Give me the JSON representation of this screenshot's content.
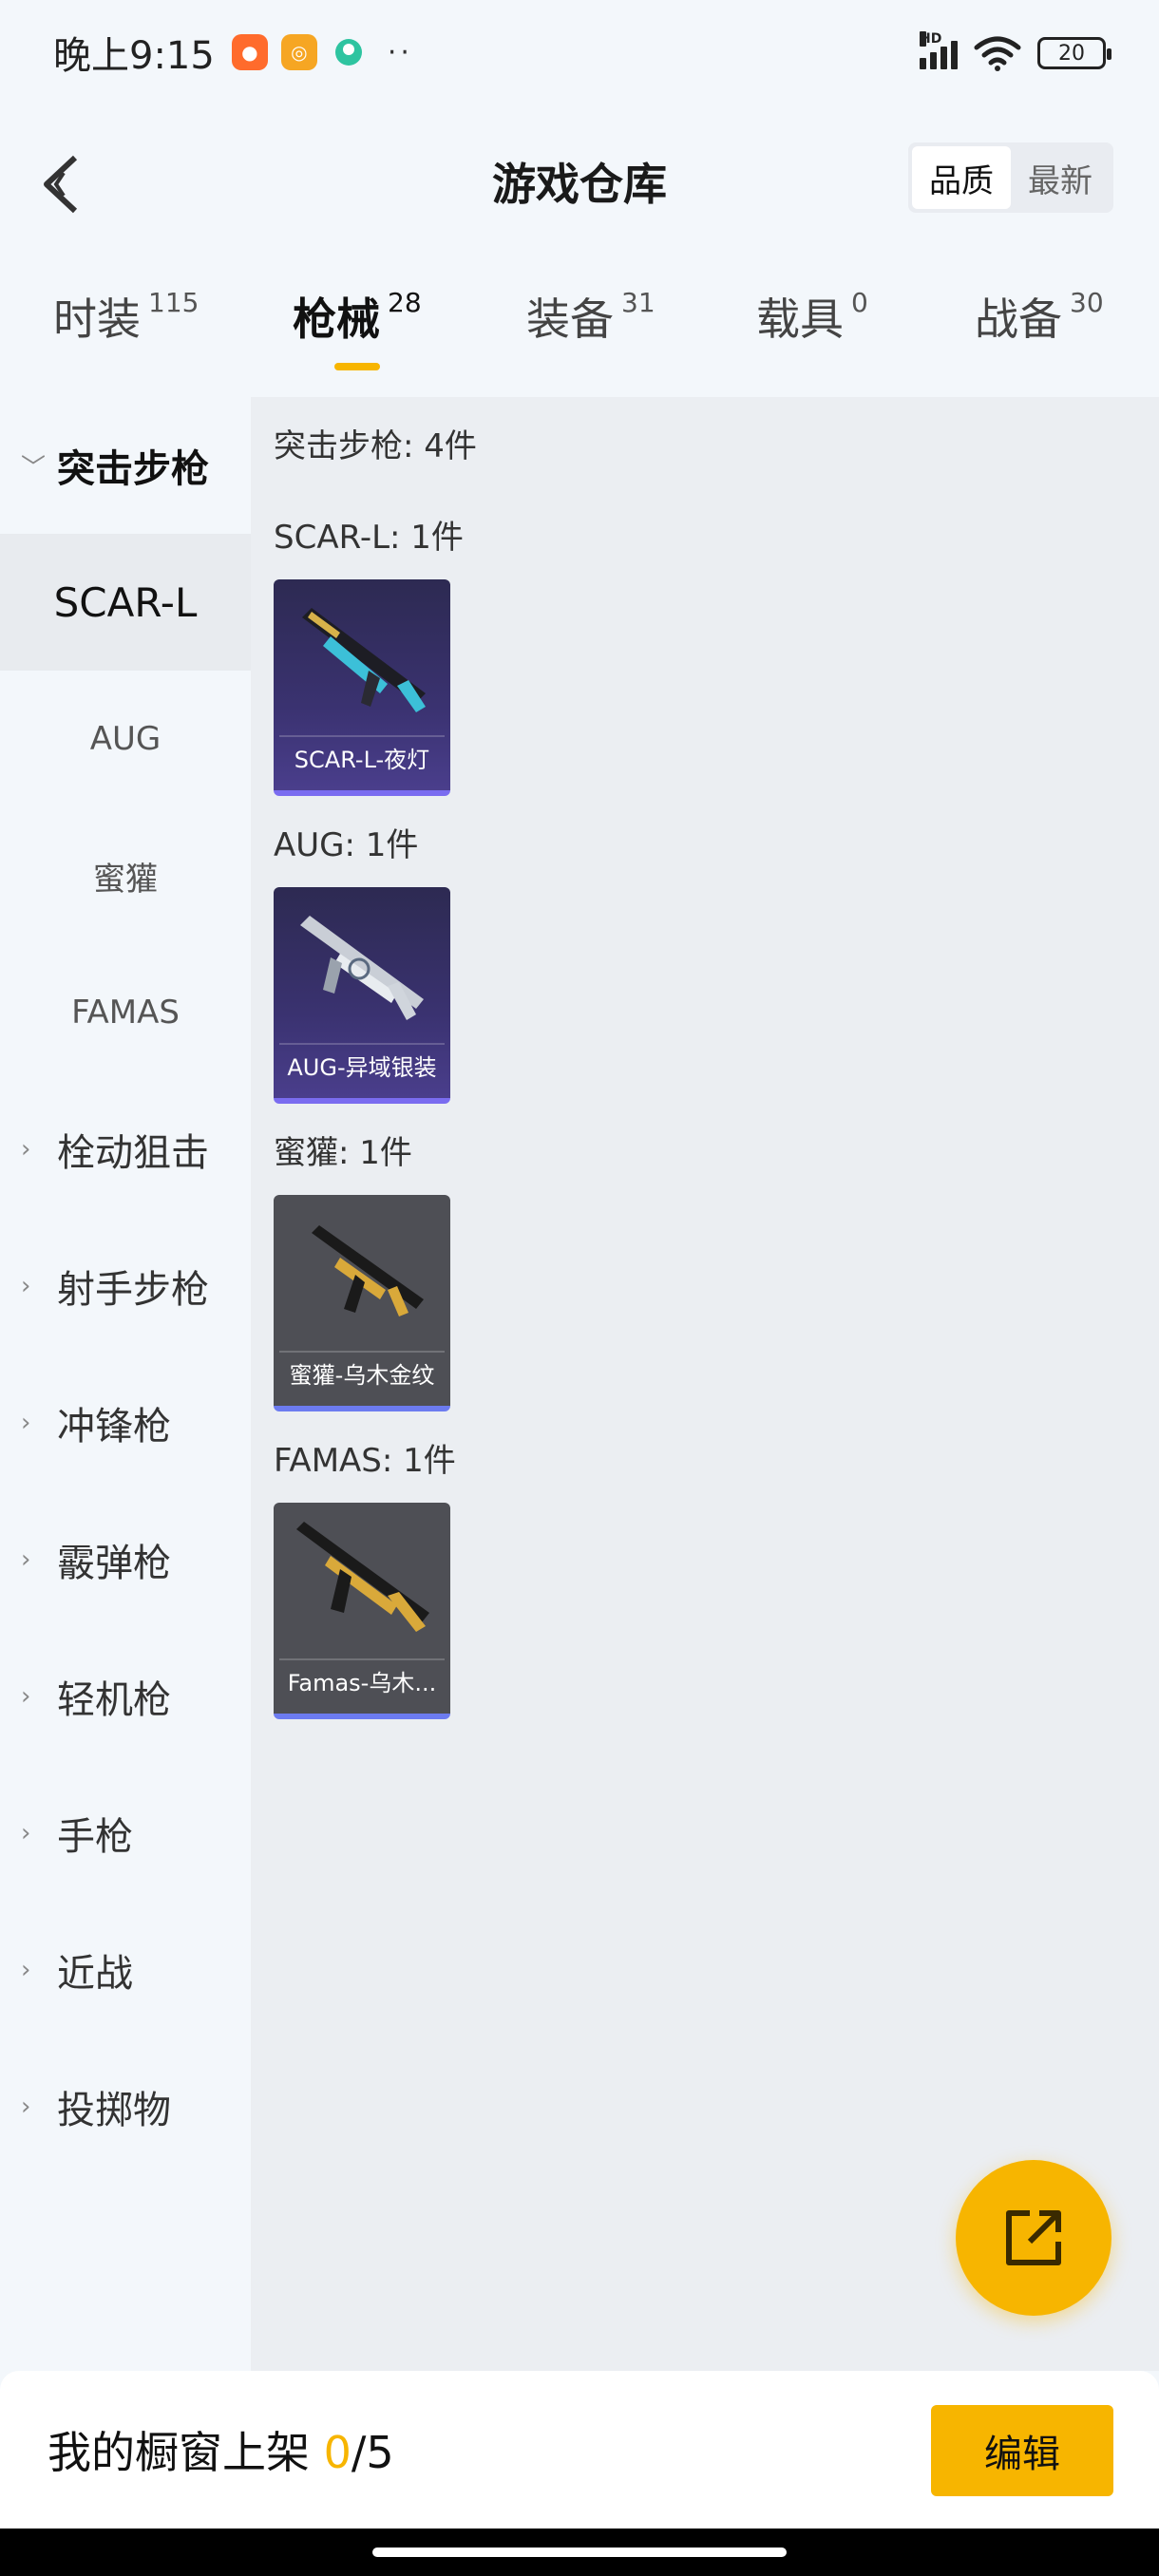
{
  "status_bar": {
    "time": "晚上9:15",
    "battery": "20",
    "network_badge": "HD",
    "dots": "··"
  },
  "header": {
    "title": "游戏仓库",
    "sort_options": [
      {
        "label": "品质",
        "active": true
      },
      {
        "label": "最新",
        "active": false
      }
    ]
  },
  "tabs": [
    {
      "label": "时装",
      "count": "115",
      "active": false
    },
    {
      "label": "枪械",
      "count": "28",
      "active": true
    },
    {
      "label": "装备",
      "count": "31",
      "active": false
    },
    {
      "label": "载具",
      "count": "0",
      "active": false
    },
    {
      "label": "战备",
      "count": "30",
      "active": false
    }
  ],
  "sidebar": {
    "expanded_group": "突击步枪",
    "sub_items": [
      {
        "label": "SCAR-L",
        "active": true
      },
      {
        "label": "AUG",
        "active": false
      },
      {
        "label": "蜜獾",
        "active": false
      },
      {
        "label": "FAMAS",
        "active": false
      }
    ],
    "groups": [
      "栓动狙击",
      "射手步枪",
      "冲锋枪",
      "霰弹枪",
      "轻机枪",
      "手枪",
      "近战",
      "投掷物"
    ]
  },
  "content": {
    "category_summary": "突击步枪: 4件",
    "sections": [
      {
        "heading": "SCAR-L: 1件",
        "items": [
          {
            "name": "SCAR-L-夜灯",
            "rarity": "purple",
            "icon": "rifle-icon"
          }
        ]
      },
      {
        "heading": "AUG: 1件",
        "items": [
          {
            "name": "AUG-异域银装",
            "rarity": "purple",
            "icon": "rifle-icon"
          }
        ]
      },
      {
        "heading": "蜜獾: 1件",
        "items": [
          {
            "name": "蜜獾-乌木金纹",
            "rarity": "gray",
            "icon": "rifle-icon"
          }
        ]
      },
      {
        "heading": "FAMAS: 1件",
        "items": [
          {
            "name": "Famas-乌木...",
            "rarity": "gray",
            "icon": "rifle-icon"
          }
        ]
      }
    ]
  },
  "showcase": {
    "label": "我的橱窗上架 ",
    "count": "0",
    "total": "/5",
    "edit_label": "编辑"
  },
  "colors": {
    "accent": "#f7b500",
    "purple_card": "#3a3270",
    "gray_card": "#4e4f55"
  }
}
